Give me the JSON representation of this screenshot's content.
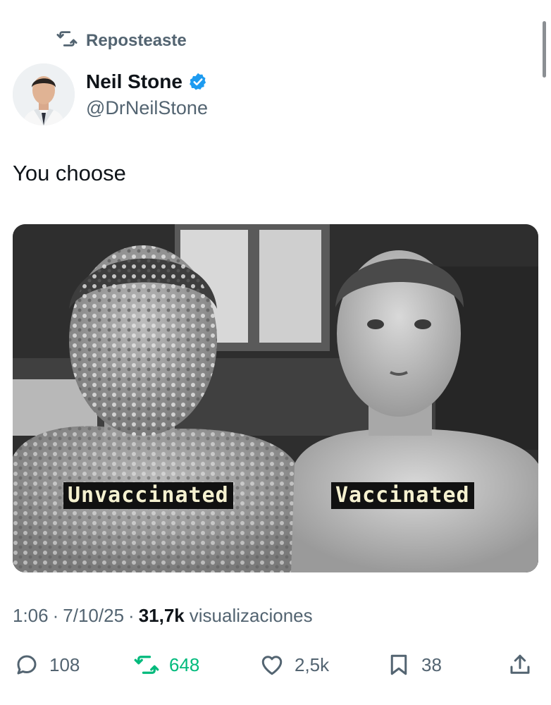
{
  "repost_banner": {
    "label": "Reposteaste",
    "icon": "repost-icon"
  },
  "author": {
    "name": "Neil Stone",
    "handle": "@DrNeilStone",
    "verified": true,
    "verified_color": "#1d9bf0",
    "avatar_icon": "avatar"
  },
  "post": {
    "text": "You choose",
    "image": {
      "label_left": "Unvaccinated",
      "label_right": "Vaccinated"
    }
  },
  "meta": {
    "time": "1:06",
    "date": "7/10/25",
    "views_count": "31,7k",
    "views_label": "visualizaciones"
  },
  "actions": {
    "replies": {
      "count": "108",
      "icon": "reply-icon"
    },
    "reposts": {
      "count": "648",
      "icon": "repost-icon",
      "color": "#00ba7c"
    },
    "likes": {
      "count": "2,5k",
      "icon": "heart-icon"
    },
    "bookmarks": {
      "count": "38",
      "icon": "bookmark-icon"
    },
    "share": {
      "icon": "share-icon"
    }
  }
}
